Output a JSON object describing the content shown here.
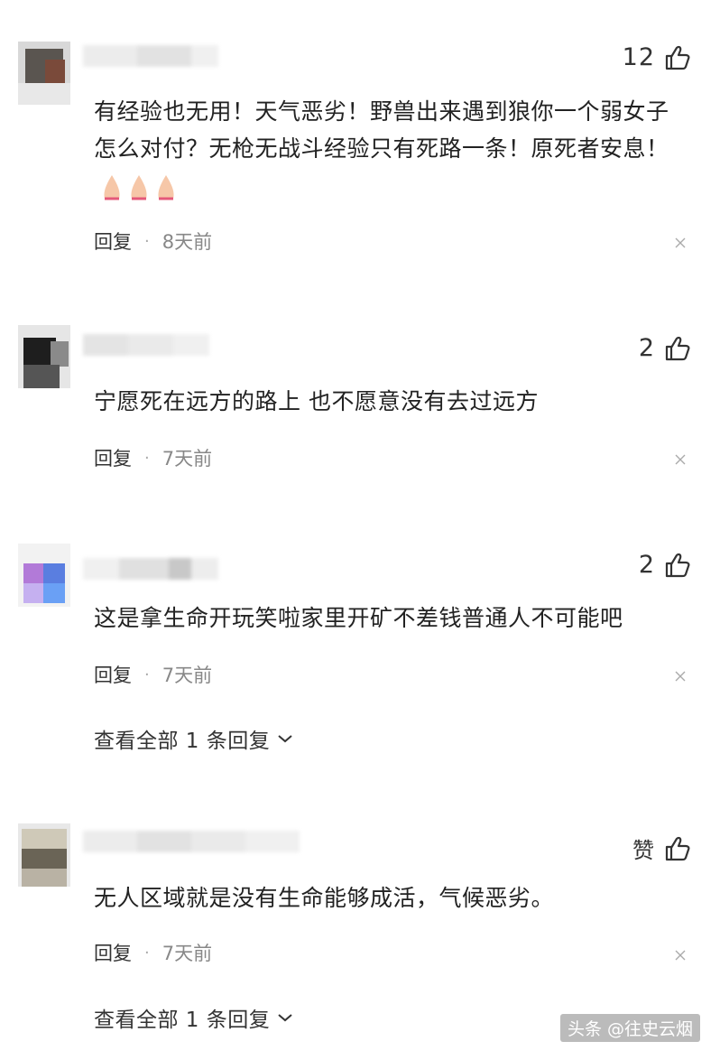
{
  "comments": [
    {
      "likes": "12",
      "text": "有经验也无用！天气恶劣！野兽出来遇到狼你一个弱女子怎么对付？无枪无战斗经验只有死路一条！原死者安息！",
      "emoji": "praying-hands-emoji",
      "reply_label": "回复",
      "separator": "·",
      "time": "8天前"
    },
    {
      "likes": "2",
      "text": "宁愿死在远方的路上 也不愿意没有去过远方",
      "reply_label": "回复",
      "separator": "·",
      "time": "7天前"
    },
    {
      "likes": "2",
      "text": "这是拿生命开玩笑啦家里开矿不差钱普通人不可能吧",
      "reply_label": "回复",
      "separator": "·",
      "time": "7天前",
      "view_replies": "查看全部 1 条回复"
    },
    {
      "likes": "赞",
      "text": "无人区域就是没有生命能够成活，气候恶劣。",
      "reply_label": "回复",
      "separator": "·",
      "time": "7天前",
      "view_replies": "查看全部 1 条回复"
    }
  ],
  "icons": {
    "like": "thumbs-up-icon",
    "close": "close-icon",
    "expand": "chevron-down-icon"
  },
  "watermark": "头条 @往史云烟",
  "colors": {
    "text": "#222222",
    "meta_time": "#888888",
    "icon": "#333333"
  }
}
